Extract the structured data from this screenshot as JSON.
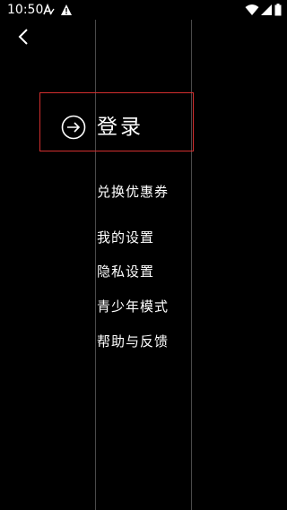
{
  "status_bar": {
    "time": "10:50",
    "left_icons": [
      "font-a-icon",
      "warning-icon"
    ],
    "right_icons": [
      "wifi-icon",
      "signal-icon",
      "battery-icon"
    ]
  },
  "nav": {
    "back_icon": "chevron-left-icon"
  },
  "login": {
    "label": "登录",
    "icon": "arrow-circle-right-icon",
    "highlight_color": "#d32f2f"
  },
  "menu": {
    "items": [
      {
        "label": "兑换优惠券"
      },
      {
        "label": "我的设置"
      },
      {
        "label": "隐私设置"
      },
      {
        "label": "青少年模式"
      },
      {
        "label": "帮助与反馈"
      }
    ]
  },
  "colors": {
    "background": "#000000",
    "text": "#ffffff",
    "divider": "#4a4a4a"
  }
}
